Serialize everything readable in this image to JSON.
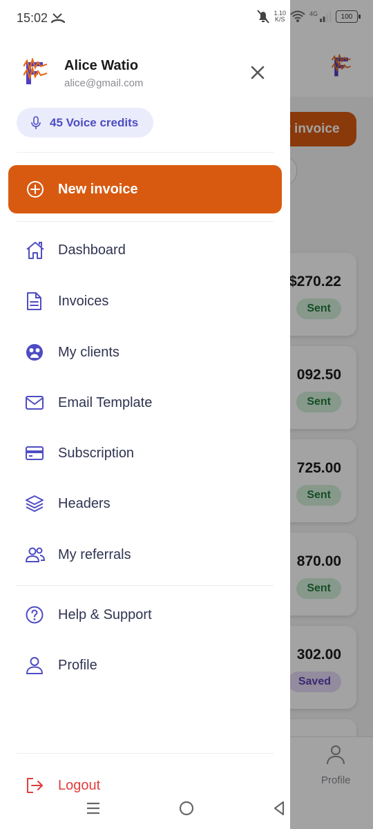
{
  "status_bar": {
    "time": "15:02",
    "net_speed_value": "1.10",
    "net_speed_unit": "K/S",
    "network": "4G",
    "battery": "100"
  },
  "drawer": {
    "user": {
      "name": "Alice Watio",
      "email": "alice@gmail.com"
    },
    "credits_label": "45 Voice credits",
    "new_invoice_label": "New invoice",
    "menu": [
      {
        "label": "Dashboard",
        "icon": "home-icon"
      },
      {
        "label": "Invoices",
        "icon": "document-icon"
      },
      {
        "label": "My clients",
        "icon": "clients-icon"
      },
      {
        "label": "Email Template",
        "icon": "mail-icon"
      },
      {
        "label": "Subscription",
        "icon": "credit-card-icon"
      },
      {
        "label": "Headers",
        "icon": "layers-icon"
      },
      {
        "label": "My referrals",
        "icon": "users-icon"
      }
    ],
    "secondary_menu": [
      {
        "label": "Help & Support",
        "icon": "help-icon"
      },
      {
        "label": "Profile",
        "icon": "user-icon"
      }
    ],
    "logout_label": "Logout"
  },
  "background": {
    "new_invoice_partial": "w invoice",
    "cards": [
      {
        "amount": "$270.22",
        "status": "Sent"
      },
      {
        "amount": "092.50",
        "status": "Sent"
      },
      {
        "amount": "725.00",
        "status": "Sent"
      },
      {
        "amount": "870.00",
        "status": "Sent"
      },
      {
        "amount": "302.00",
        "status": "Saved"
      }
    ],
    "bottom_nav_profile": "Profile"
  },
  "colors": {
    "accent": "#d85a10",
    "icon": "#4e4cc2",
    "logout": "#e23b3b",
    "sent_bg": "#d2efd9",
    "saved_bg": "#e4dcf7"
  }
}
